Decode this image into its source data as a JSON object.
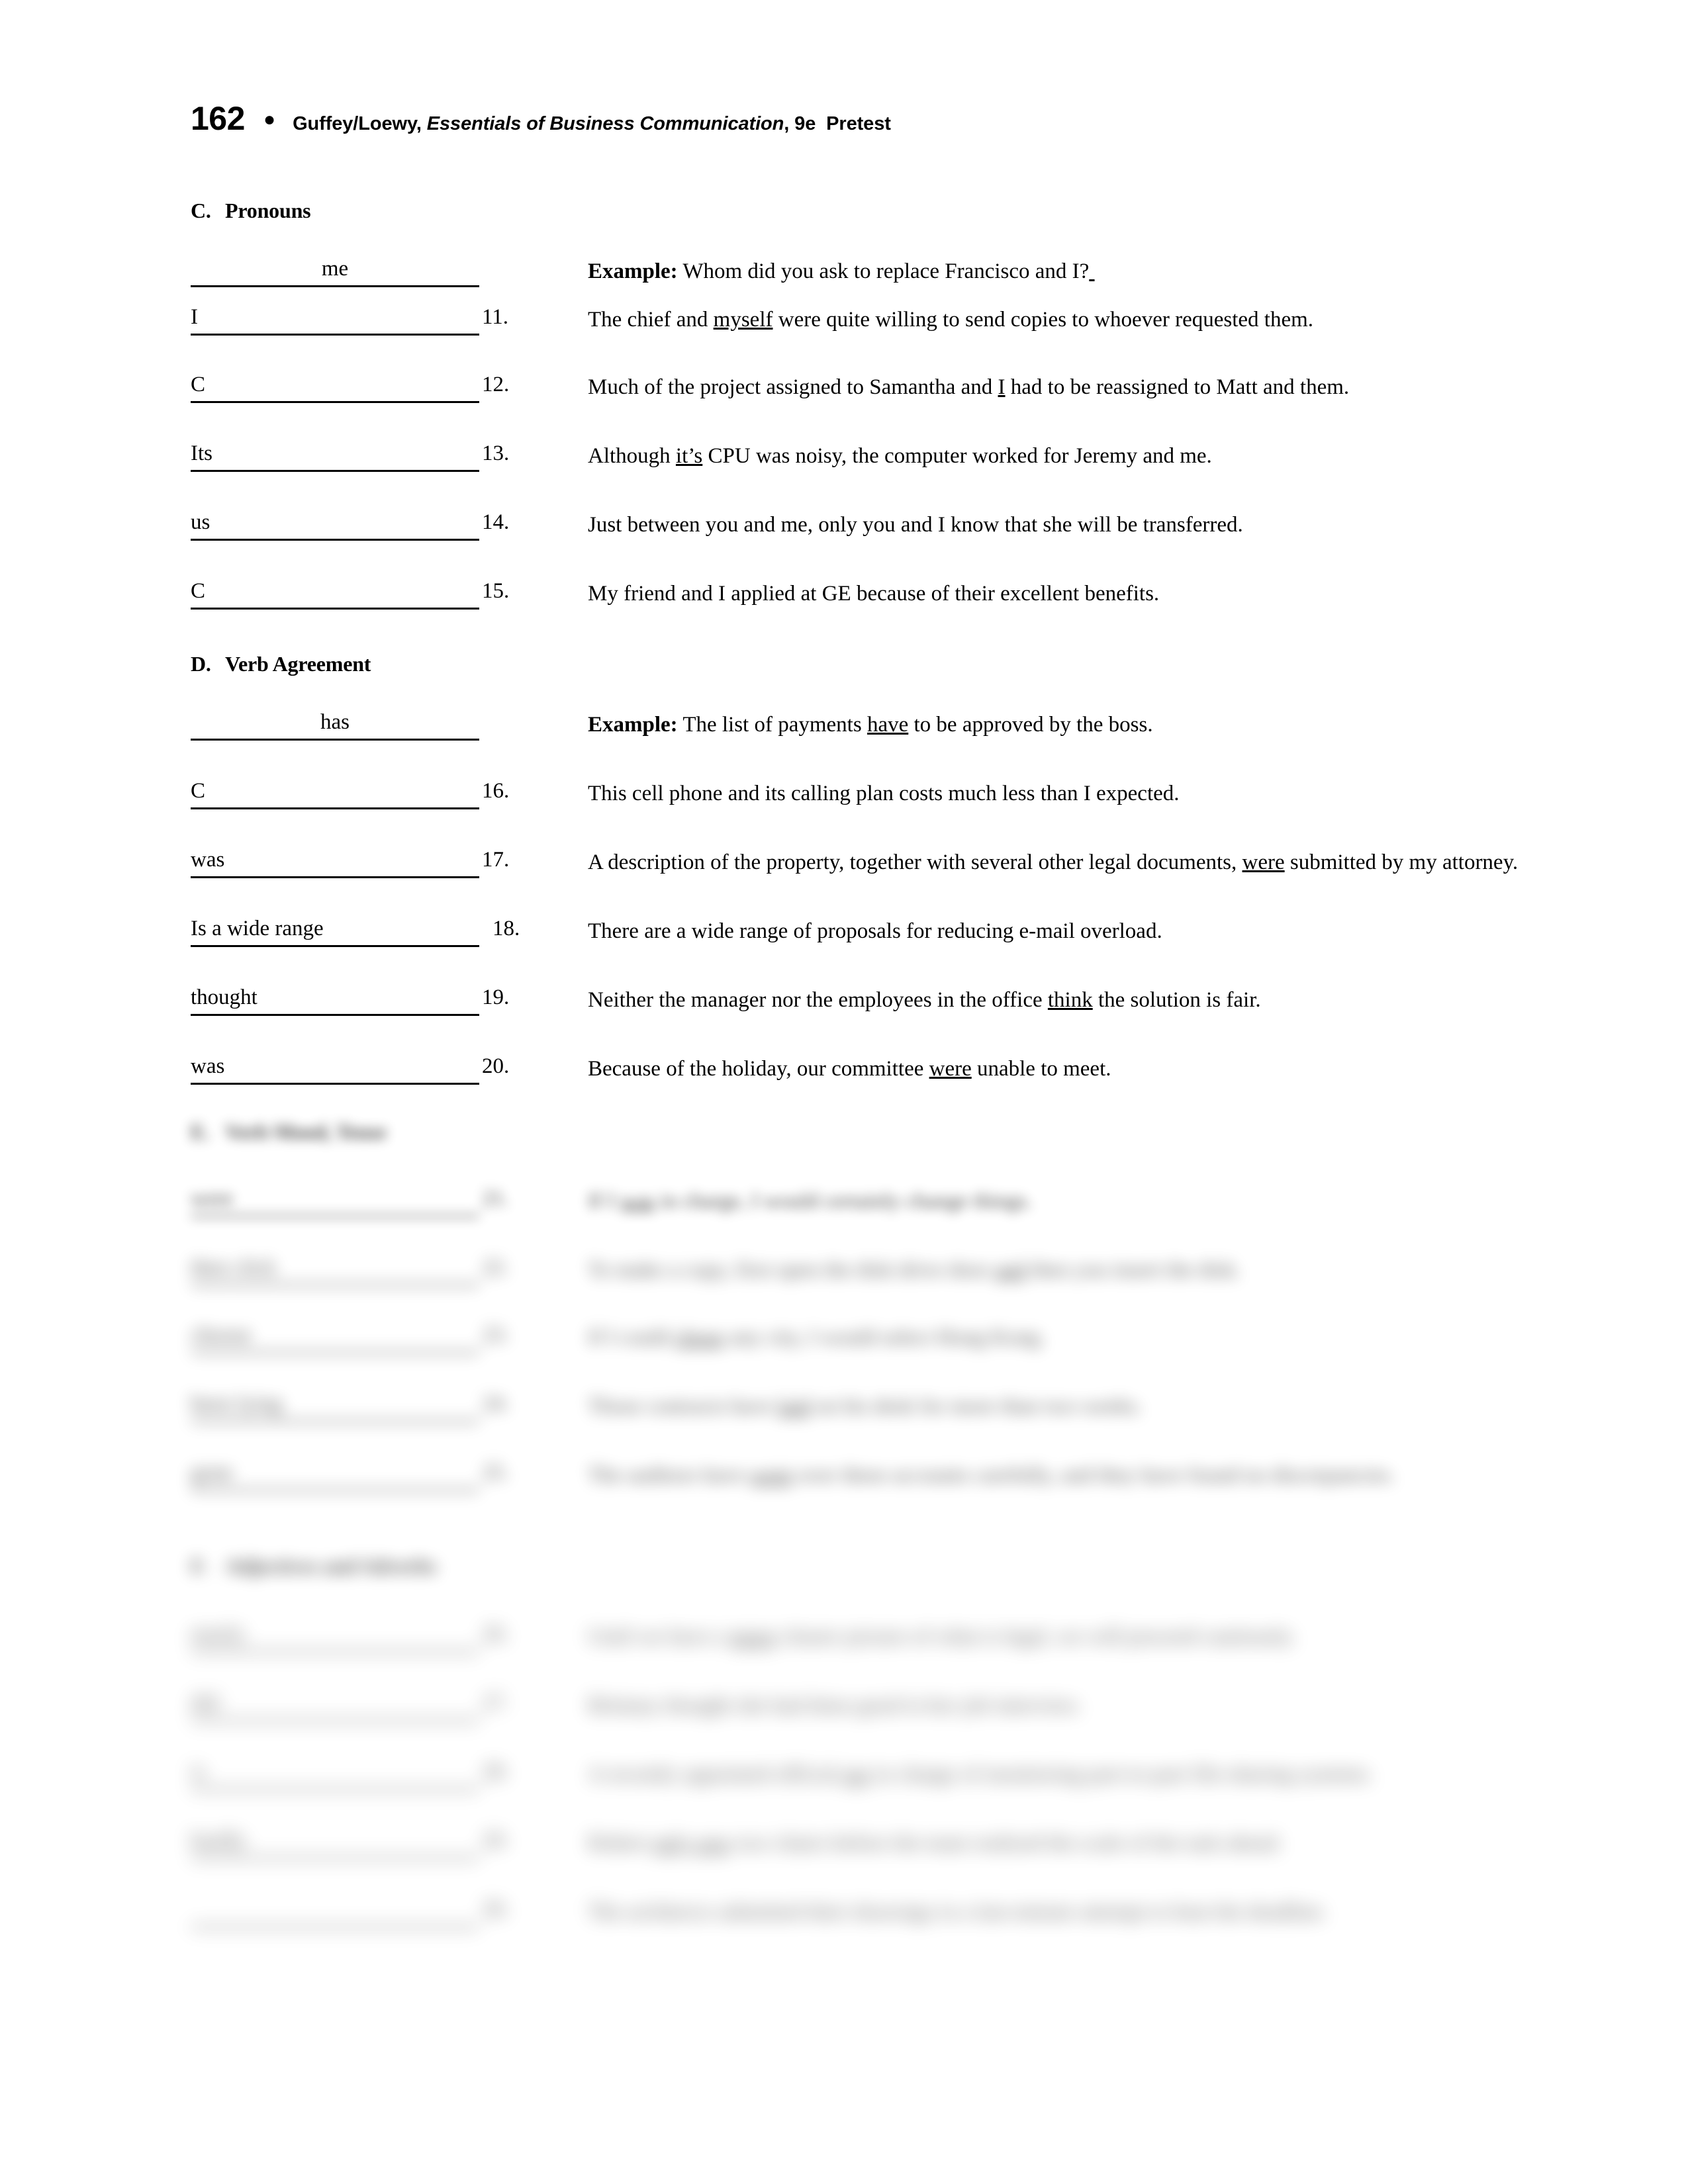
{
  "running_head": {
    "page_number": "162",
    "bullet": "●",
    "authors": "Guffey/Loewy,",
    "book_title_italic": "Essentials of Business Communication",
    "edition": ", 9e",
    "doc_type": "Pretest"
  },
  "sections": [
    {
      "letter": "C.",
      "title": "Pronouns",
      "example": {
        "answer": "me",
        "label": "Example:",
        "sentence": "Whom did you ask to replace Francisco and I?"
      },
      "items": [
        {
          "answer": "I",
          "number": "11.",
          "sentence_parts": [
            {
              "text": "The chief and ",
              "underline": false
            },
            {
              "text": "myself",
              "underline": true
            },
            {
              "text": " were quite willing to send copies to whoever requested them.",
              "underline": false
            }
          ]
        },
        {
          "answer": "C",
          "number": "12.",
          "sentence_parts": [
            {
              "text": "Much of the project assigned to Samantha and ",
              "underline": false
            },
            {
              "text": "I",
              "underline": true
            },
            {
              "text": " had to be reassigned to Matt and them.",
              "underline": false
            }
          ]
        },
        {
          "answer": "Its",
          "number": "13.",
          "sentence_parts": [
            {
              "text": "Although ",
              "underline": false
            },
            {
              "text": "it’s",
              "underline": true
            },
            {
              "text": " CPU was noisy, the computer worked for Jeremy and me.",
              "underline": false
            }
          ]
        },
        {
          "answer": "us",
          "number": "14.",
          "sentence_parts": [
            {
              "text": "Just between you and me, only you and I know that she will be transferred.",
              "underline": false
            }
          ]
        },
        {
          "answer": "C",
          "number": "15.",
          "sentence_parts": [
            {
              "text": "My friend and I applied at GE because of their excellent benefits.",
              "underline": false
            }
          ]
        }
      ]
    },
    {
      "letter": "D.",
      "title": "Verb Agreement",
      "example": {
        "answer": "has",
        "label": "Example:",
        "sentence_pre": "The list of payments ",
        "sentence_underline": "have",
        "sentence_post": " to be approved by the boss."
      },
      "items": [
        {
          "answer": "C",
          "number": "16.",
          "sentence_parts": [
            {
              "text": "This cell phone and its calling plan costs much less than I expected.",
              "underline": false
            }
          ]
        },
        {
          "answer": "was",
          "number": "17.",
          "sentence_parts": [
            {
              "text": "A description of the property, together with several other legal documents, ",
              "underline": false
            },
            {
              "text": "were",
              "underline": true
            },
            {
              "text": " submitted by my attorney.",
              "underline": false
            }
          ]
        },
        {
          "answer": "Is a wide range",
          "number": "18.",
          "sentence_parts": [
            {
              "text": "There are a wide range of proposals for reducing e-mail overload.",
              "underline": false
            }
          ]
        },
        {
          "answer": "thought",
          "number": "19.",
          "sentence_parts": [
            {
              "text": "Neither the manager nor the employees in the office ",
              "underline": false
            },
            {
              "text": "think",
              "underline": true
            },
            {
              "text": " the solution is fair.",
              "underline": false
            }
          ]
        },
        {
          "answer": "was",
          "number": "20.",
          "sentence_parts": [
            {
              "text": "Because of the holiday, our committee ",
              "underline": false
            },
            {
              "text": "were",
              "underline": true
            },
            {
              "text": " unable to meet.",
              "underline": false
            }
          ]
        }
      ]
    },
    {
      "letter": "E.",
      "title": "Verb Mood, Tense",
      "blurred": true,
      "items": [
        {
          "answer": "were",
          "number": "21.",
          "sentence_parts": [
            {
              "text": "If I ",
              "underline": false
            },
            {
              "text": "was",
              "underline": true
            },
            {
              "text": " in charge, I would certainly change things.",
              "underline": false
            }
          ]
        },
        {
          "answer": "then click",
          "number": "22.",
          "sentence_parts": [
            {
              "text": "To make a copy, first open the disk drive door ",
              "underline": false
            },
            {
              "text": "and",
              "underline": true
            },
            {
              "text": " then you insert the disk.",
              "underline": false
            }
          ]
        },
        {
          "answer": "choose",
          "number": "23.",
          "sentence_parts": [
            {
              "text": "If I could ",
              "underline": false
            },
            {
              "text": "chose",
              "underline": true
            },
            {
              "text": " any city, I would select Hong Kong.",
              "underline": false
            }
          ]
        },
        {
          "answer": "been lying",
          "number": "24.",
          "sentence_parts": [
            {
              "text": "Those contracts have ",
              "underline": false
            },
            {
              "text": "laid",
              "underline": true
            },
            {
              "text": " on his desk for more than two weeks.",
              "underline": false
            }
          ]
        },
        {
          "answer": "gone",
          "number": "25.",
          "sentence_parts": [
            {
              "text": "The auditors have ",
              "underline": false
            },
            {
              "text": "went",
              "underline": true
            },
            {
              "text": " over these accounts carefully, and they have found no discrepancies.",
              "underline": false
            }
          ]
        }
      ]
    },
    {
      "letter": "F.",
      "title": "Adjectives and Adverbs",
      "blurred": true,
      "items": [
        {
          "answer": "nearly",
          "number": "26.",
          "sentence_parts": [
            {
              "text": "Until we have a ",
              "underline": false
            },
            {
              "text": "more",
              "underline": true
            },
            {
              "text": " clearer picture of what is legal, we will proceed cautiously.",
              "underline": false
            }
          ]
        },
        {
          "answer": "did",
          "number": "27.",
          "sentence_parts": [
            {
              "text": "Brittany thought she had done good in her job interview.",
              "underline": false
            }
          ]
        },
        {
          "answer": "is",
          "number": "28.",
          "sentence_parts": [
            {
              "text": "A recently appointed official ",
              "underline": false
            },
            {
              "text": "are",
              "underline": true
            },
            {
              "text": " in charge of monitoring part-to-part file-sharing systems.",
              "underline": false
            }
          ]
        },
        {
          "answer": "hardly",
          "number": "29.",
          "sentence_parts": [
            {
              "text": "Robert ",
              "underline": false
            },
            {
              "text": "only saw",
              "underline": true
            },
            {
              "text": " two chairs before the team realized the scale of the task ahead.",
              "underline": false
            }
          ]
        },
        {
          "answer": "",
          "number": "30.",
          "sentence_parts": [
            {
              "text": "The architects submitted their drawings in a last-minute attempt to beat the deadline.",
              "underline": false
            }
          ]
        }
      ]
    }
  ]
}
